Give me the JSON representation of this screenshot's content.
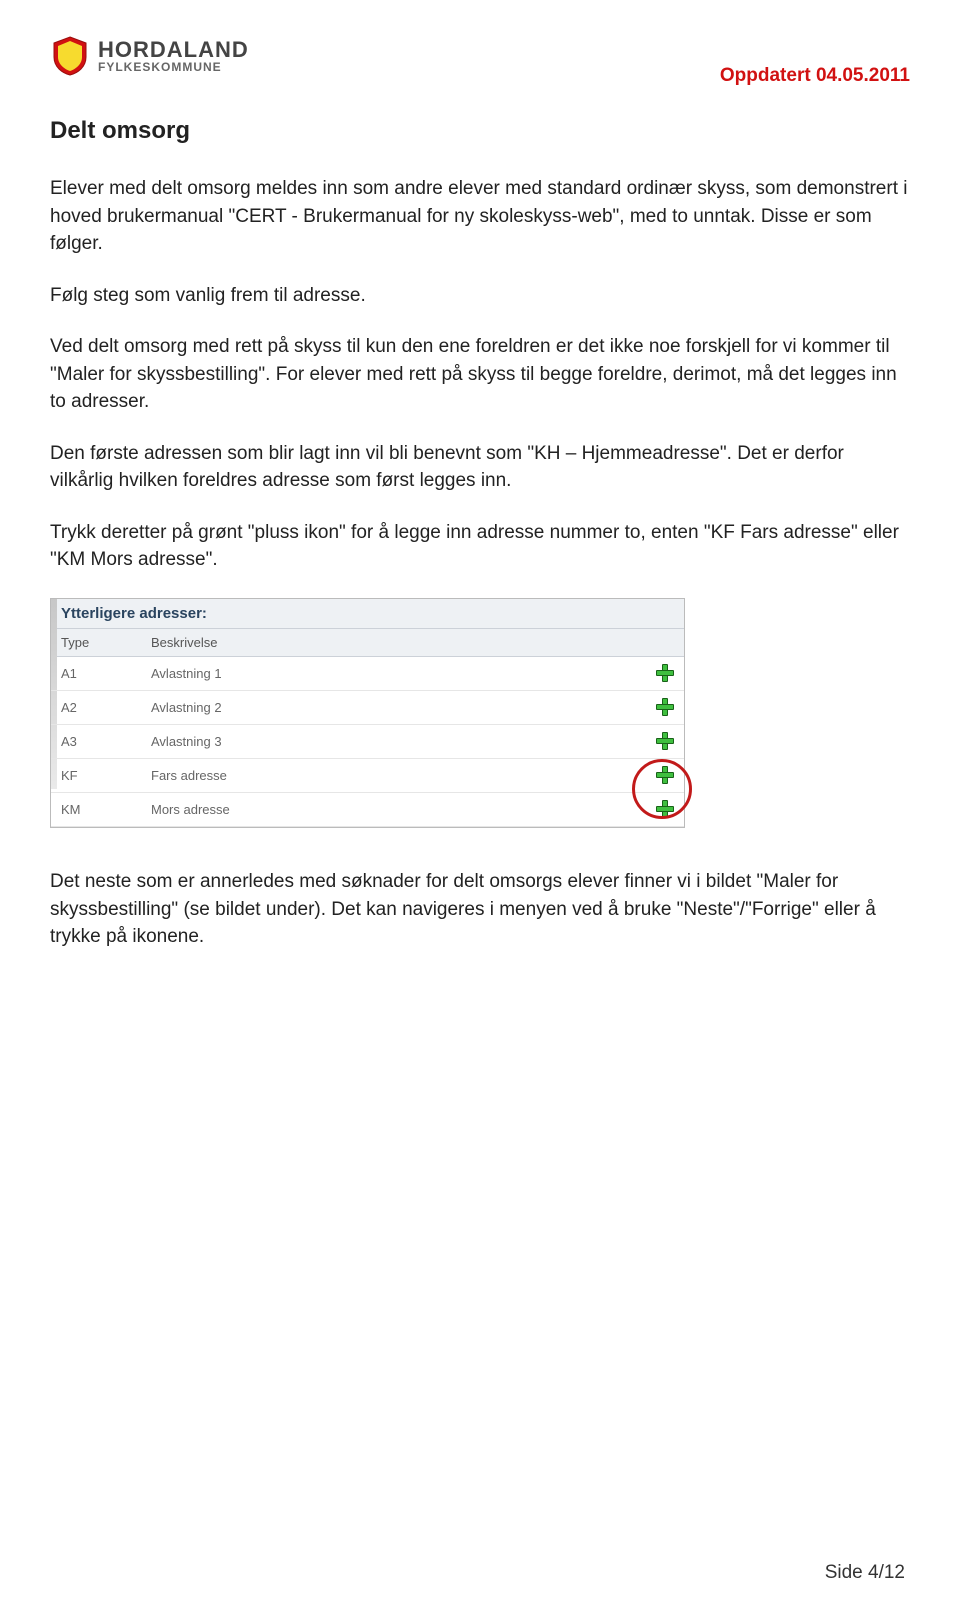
{
  "header": {
    "org_name": "HORDALAND",
    "org_sub": "FYLKESKOMMUNE",
    "updated": "Oppdatert 04.05.2011"
  },
  "title": "Delt omsorg",
  "paragraphs": {
    "p1": "Elever med delt omsorg meldes inn som andre elever med standard ordinær skyss, som demonstrert i hoved brukermanual \"CERT - Brukermanual for ny skoleskyss-web\", med to unntak. Disse er som følger.",
    "p2": "Følg steg som vanlig frem til adresse.",
    "p3": "Ved delt omsorg med rett på skyss til kun den ene foreldren er det ikke noe forskjell for vi kommer til \"Maler for skyssbestilling\". For elever med rett på skyss til begge foreldre, derimot, må det legges inn to adresser.",
    "p4": "Den første adressen som blir lagt inn vil bli benevnt som \"KH – Hjemmeadresse\". Det er derfor vilkårlig hvilken foreldres adresse som først legges inn.",
    "p5": "Trykk deretter på grønt \"pluss ikon\" for å legge inn adresse nummer to, enten \"KF Fars adresse\" eller \"KM Mors adresse\".",
    "p6": "Det neste som er annerledes med søknader for delt omsorgs elever finner vi i bildet \"Maler for skyssbestilling\" (se bildet under). Det kan navigeres i menyen ved å bruke \"Neste\"/\"Forrige\" eller å trykke på ikonene."
  },
  "embed": {
    "panel_title": "Ytterligere adresser:",
    "col_type": "Type",
    "col_desc": "Beskrivelse",
    "rows": [
      {
        "type": "A1",
        "desc": "Avlastning 1"
      },
      {
        "type": "A2",
        "desc": "Avlastning 2"
      },
      {
        "type": "A3",
        "desc": "Avlastning 3"
      },
      {
        "type": "KF",
        "desc": "Fars adresse"
      },
      {
        "type": "KM",
        "desc": "Mors adresse"
      }
    ]
  },
  "footer": {
    "page": "Side 4/12"
  }
}
